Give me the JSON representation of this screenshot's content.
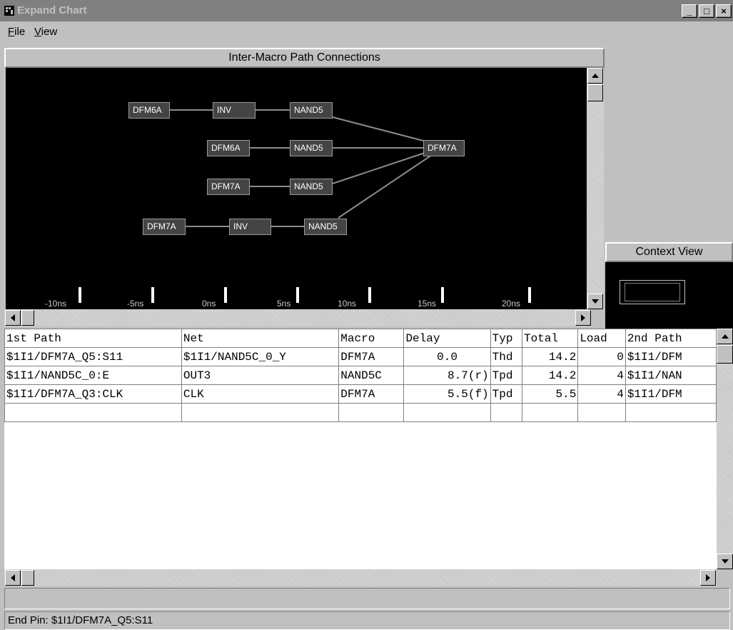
{
  "window": {
    "title": "Expand Chart",
    "buttons": [
      "_",
      "□",
      "×"
    ]
  },
  "menu": [
    {
      "label_u": "F",
      "label_rest": "ile"
    },
    {
      "label_u": "V",
      "label_rest": "iew"
    }
  ],
  "graph": {
    "title": "Inter-Macro Path Connections",
    "nodes": [
      "DFM6A",
      "INV",
      "NAND5",
      "DFM6A",
      "NAND5",
      "DFM7A",
      "DFM7A",
      "NAND5",
      "DFM7A",
      "INV",
      "NAND5"
    ],
    "time_ticks": [
      "-10ns",
      "-5ns",
      "0ns",
      "5ns",
      "10ns",
      "15ns",
      "20ns"
    ]
  },
  "context": {
    "title": "Context View"
  },
  "table": {
    "headers": [
      "1st Path",
      "Net",
      "Macro",
      "Delay",
      "Typ",
      "Total",
      "Load",
      "2nd Path"
    ],
    "rows": [
      [
        "$1I1/DFM7A_Q5:S11",
        "$1I1/NAND5C_0_Y",
        "DFM7A",
        "0.0",
        "Thd",
        "14.2",
        "0",
        "$1I1/DFM"
      ],
      [
        "$1I1/NAND5C_0:E",
        "OUT3",
        "NAND5C",
        "8.7(r)",
        "Tpd",
        "14.2",
        "4",
        "$1I1/NAN"
      ],
      [
        "$1I1/DFM7A_Q3:CLK",
        "CLK",
        "DFM7A",
        "5.5(f)",
        "Tpd",
        "5.5",
        "4",
        "$1I1/DFM"
      ]
    ]
  },
  "status": {
    "text": "End Pin: $1I1/DFM7A_Q5:S11"
  },
  "colors": {
    "titlebar": "#808080",
    "canvas": "#000000",
    "node": "#444444",
    "edge": "#8c8c8c"
  }
}
